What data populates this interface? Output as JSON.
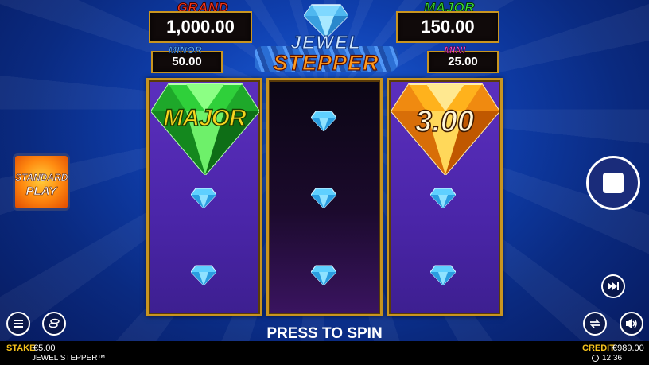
{
  "jackpots": {
    "grand": {
      "label": "GRAND",
      "value": "1,000.00"
    },
    "major": {
      "label": "MAJOR",
      "value": "150.00"
    },
    "minor": {
      "label": "MINOR",
      "value": "50.00"
    },
    "mini": {
      "label": "MINI",
      "value": "25.00"
    }
  },
  "logo": {
    "line1": "JEWEL",
    "line2": "STEPPER"
  },
  "reels": {
    "reel1_prize": "MAJOR",
    "reel3_prize": "3.00",
    "colors": {
      "green_gem": "#2fd03a",
      "yellow_gem": "#ffb21c",
      "blue_gem": "#5fd0ff"
    }
  },
  "side_button": {
    "line1": "STANDARD",
    "line2": "PLAY"
  },
  "controls": {
    "press_to_spin": "PRESS TO SPIN",
    "icons": [
      "menu-icon",
      "coins-icon",
      "fast-forward-icon",
      "autoplay-icon",
      "sound-icon",
      "stop-icon"
    ]
  },
  "footer": {
    "stake_label": "STAKE",
    "stake_value": "€5.00",
    "game_name": "JEWEL STEPPER™",
    "credit_label": "CREDIT",
    "credit_value": "€989.00",
    "time": "12:36"
  }
}
